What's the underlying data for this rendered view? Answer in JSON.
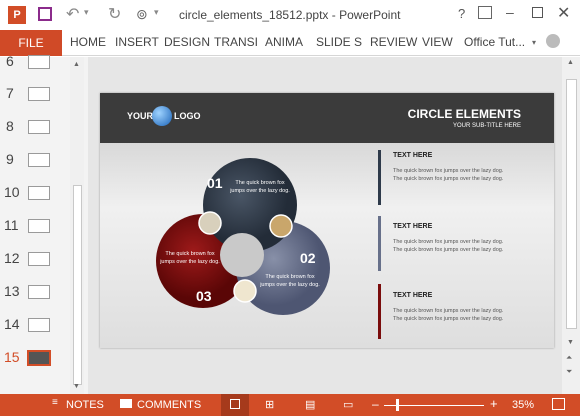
{
  "window": {
    "title": "circle_elements_18512.pptx - PowerPoint"
  },
  "ribbon": {
    "file": "FILE",
    "tabs": [
      "HOME",
      "INSERT",
      "DESIGN",
      "TRANSI",
      "ANIMA",
      "SLIDE S",
      "REVIEW",
      "VIEW"
    ],
    "account": "Office Tut..."
  },
  "thumbs": [
    {
      "n": "6"
    },
    {
      "n": "7"
    },
    {
      "n": "8"
    },
    {
      "n": "9"
    },
    {
      "n": "10"
    },
    {
      "n": "11"
    },
    {
      "n": "12"
    },
    {
      "n": "13"
    },
    {
      "n": "14"
    },
    {
      "n": "15"
    }
  ],
  "slide": {
    "logo_left": "YOUR",
    "logo_right": "LOGO",
    "title": "CIRCLE ELEMENTS",
    "subtitle": "YOUR SUB-TITLE HERE",
    "circles": [
      {
        "num": "01",
        "text": "The quick brown fox jumps over the lazy dog."
      },
      {
        "num": "02",
        "text": "The quick brown fox jumps over the lazy dog."
      },
      {
        "num": "03",
        "text": "The quick brown fox jumps over the lazy dog."
      }
    ],
    "items": [
      {
        "title": "TEXT HERE",
        "line1": "The quick brown fox jumps over the lazy dog.",
        "line2": "The quick brown fox jumps over the lazy dog."
      },
      {
        "title": "TEXT HERE",
        "line1": "The quick brown fox jumps over the lazy dog.",
        "line2": "The quick brown fox jumps over the lazy dog."
      },
      {
        "title": "TEXT HERE",
        "line1": "The quick brown fox jumps over the lazy dog.",
        "line2": "The quick brown fox jumps over the lazy dog."
      }
    ]
  },
  "status": {
    "notes": "NOTES",
    "comments": "COMMENTS",
    "zoom": "35%"
  },
  "colors": {
    "accent": "#d24d27",
    "dark": "#2e3a4a",
    "red": "#7a0c0c",
    "blue": "#67708a"
  }
}
